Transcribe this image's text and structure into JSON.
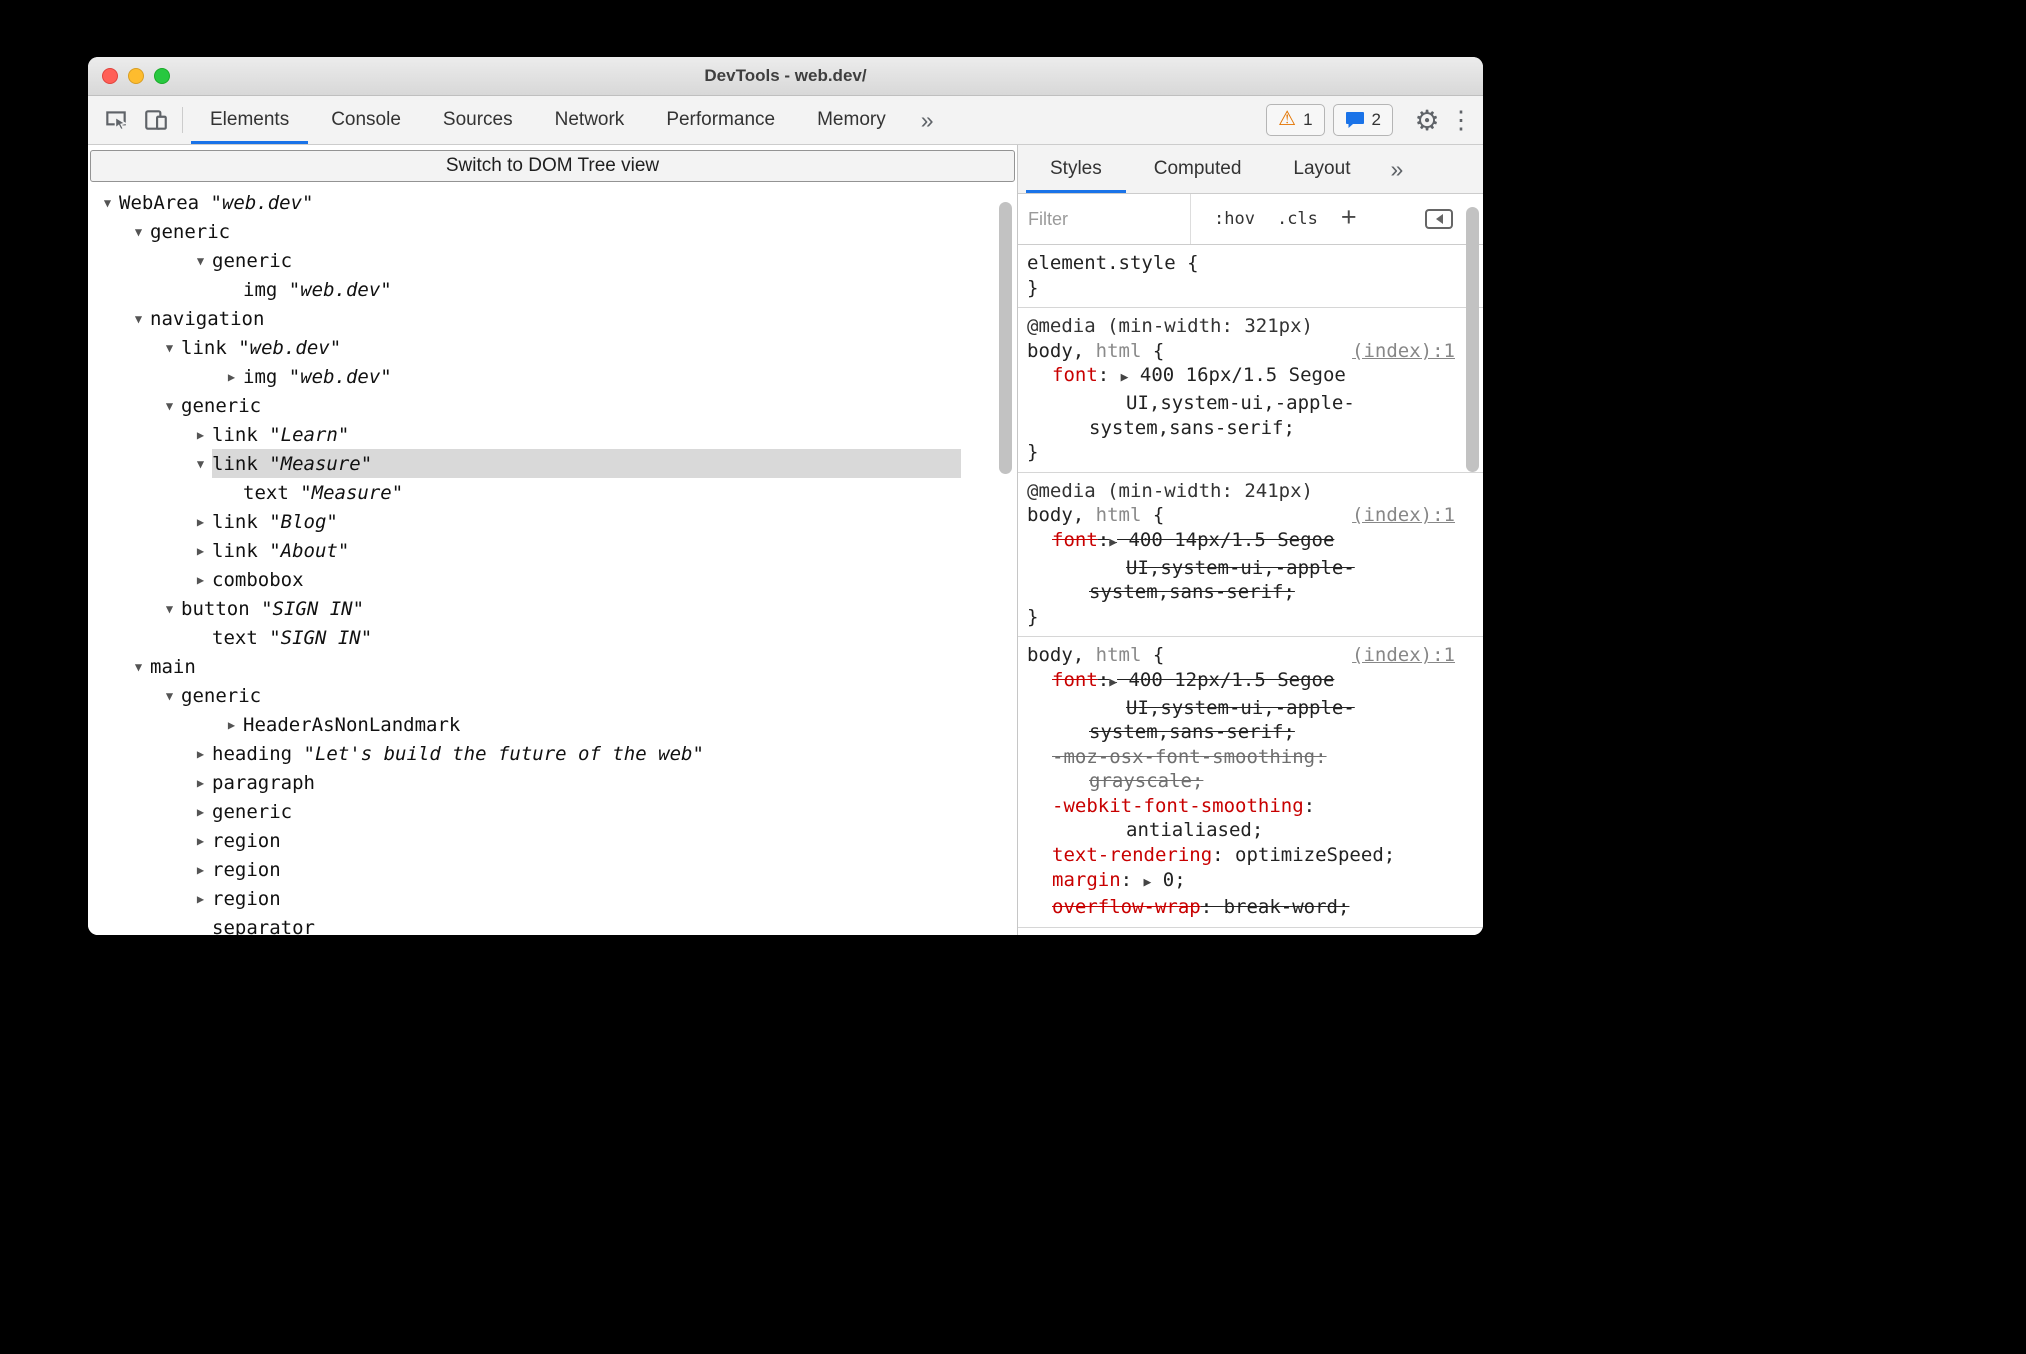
{
  "colors": {
    "accent-blue": "#1a73e8",
    "property-red": "#c80000",
    "warning-orange": "#e37400",
    "selection-gray": "#d9d9d9",
    "traffic-red": "#ff5f57",
    "traffic-yellow": "#febc2e",
    "traffic-green": "#28c840"
  },
  "window": {
    "title": "DevTools - web.dev/"
  },
  "toolbar": {
    "tabs": [
      {
        "label": "Elements",
        "active": true
      },
      {
        "label": "Console"
      },
      {
        "label": "Sources"
      },
      {
        "label": "Network"
      },
      {
        "label": "Performance"
      },
      {
        "label": "Memory"
      }
    ],
    "more_tabs": "»",
    "warning_badge": "1",
    "message_badge": "2"
  },
  "dom_switch": {
    "label": "Switch to DOM Tree view"
  },
  "accessibility_tree": {
    "rows": [
      {
        "role": "WebArea",
        "value": "web.dev",
        "state": "expanded",
        "level": 0
      },
      {
        "role": "generic",
        "state": "expanded",
        "level": 1
      },
      {
        "role": "generic",
        "state": "expanded",
        "level": 2,
        "bump": true
      },
      {
        "role": "img",
        "value": "web.dev",
        "state": "leaf",
        "level": 3,
        "bump": true
      },
      {
        "role": "navigation",
        "state": "expanded",
        "level": 1
      },
      {
        "role": "link",
        "value": "web.dev",
        "state": "expanded",
        "level": 2
      },
      {
        "role": "img",
        "value": "web.dev",
        "state": "collapsed",
        "level": 3,
        "bump": true
      },
      {
        "role": "generic",
        "state": "expanded",
        "level": 2
      },
      {
        "role": "link",
        "value": "Learn",
        "state": "collapsed",
        "level": 3
      },
      {
        "role": "link",
        "value": "Measure",
        "state": "expanded",
        "level": 3,
        "selected": true
      },
      {
        "role": "text",
        "value": "Measure",
        "state": "leaf",
        "level": 4
      },
      {
        "role": "link",
        "value": "Blog",
        "state": "collapsed",
        "level": 3
      },
      {
        "role": "link",
        "value": "About",
        "state": "collapsed",
        "level": 3
      },
      {
        "role": "combobox",
        "state": "collapsed",
        "level": 3
      },
      {
        "role": "button",
        "value": "SIGN IN",
        "state": "expanded",
        "level": 2
      },
      {
        "role": "text",
        "value": "SIGN IN",
        "state": "leaf",
        "level": 3
      },
      {
        "role": "main",
        "state": "expanded",
        "level": 1
      },
      {
        "role": "generic",
        "state": "expanded",
        "level": 2
      },
      {
        "role": "HeaderAsNonLandmark",
        "state": "collapsed",
        "level": 3,
        "bump": true
      },
      {
        "role": "heading",
        "value": "Let's build the future of the web",
        "state": "collapsed",
        "level": 3
      },
      {
        "role": "paragraph",
        "state": "collapsed",
        "level": 3
      },
      {
        "role": "generic",
        "state": "collapsed",
        "level": 3
      },
      {
        "role": "region",
        "state": "collapsed",
        "level": 3
      },
      {
        "role": "region",
        "state": "collapsed",
        "level": 3
      },
      {
        "role": "region",
        "state": "collapsed",
        "level": 3
      },
      {
        "role": "separator",
        "state": "leaf",
        "level": 3
      }
    ]
  },
  "sidebar": {
    "tabs": [
      {
        "label": "Styles",
        "active": true
      },
      {
        "label": "Computed"
      },
      {
        "label": "Layout"
      }
    ],
    "more_tabs": "»",
    "filter_placeholder": "Filter",
    "hov_label": ":hov",
    "cls_label": ".cls",
    "add_label": "+",
    "sections": [
      {
        "name": "element-style-rule",
        "lines": [
          {
            "name": "css-selector-line",
            "ind": 0,
            "spans": [
              {
                "t": "element.style {",
                "c": "sel"
              }
            ]
          },
          {
            "name": "css-close-brace",
            "ind": 0,
            "spans": [
              {
                "t": "}",
                "c": "sel"
              }
            ]
          }
        ]
      },
      {
        "name": "media-321-rule",
        "lines": [
          {
            "name": "media-query",
            "ind": 0,
            "spans": [
              {
                "t": "@media (min-width: 321px)",
                "c": "media"
              }
            ]
          },
          {
            "name": "css-selector-line",
            "ind": 0,
            "link": "(index):1",
            "spans": [
              {
                "t": "body, ",
                "c": "sel"
              },
              {
                "t": "html",
                "c": "selmuted"
              },
              {
                "t": " {",
                "c": "sel"
              }
            ]
          },
          {
            "name": "css-declaration",
            "ind": 1,
            "spans": [
              {
                "t": "font",
                "c": "prop"
              },
              {
                "t": ": ",
                "c": "plain"
              },
              {
                "t": "▶",
                "c": "arrow"
              },
              {
                "t": " 400 16px/1.5 Segoe",
                "c": "val"
              }
            ]
          },
          {
            "name": "css-value-wrap",
            "ind": 3,
            "spans": [
              {
                "t": "UI,system-ui,-apple-",
                "c": "val"
              }
            ]
          },
          {
            "name": "css-value-wrap",
            "ind": 2,
            "spans": [
              {
                "t": "system,sans-serif;",
                "c": "val"
              }
            ]
          },
          {
            "name": "css-close-brace",
            "ind": 0,
            "spans": [
              {
                "t": "}",
                "c": "sel"
              }
            ]
          }
        ]
      },
      {
        "name": "media-241-rule",
        "lines": [
          {
            "name": "media-query",
            "ind": 0,
            "spans": [
              {
                "t": "@media (min-width: 241px)",
                "c": "media"
              }
            ]
          },
          {
            "name": "css-selector-line",
            "ind": 0,
            "link": "(index):1",
            "spans": [
              {
                "t": "body, ",
                "c": "sel"
              },
              {
                "t": "html",
                "c": "selmuted"
              },
              {
                "t": " {",
                "c": "sel"
              }
            ]
          },
          {
            "name": "css-declaration",
            "ind": 1,
            "spans": [
              {
                "t": "font",
                "c": "prop",
                "s": true
              },
              {
                "t": ":",
                "c": "plain",
                "s": true
              },
              {
                "t": "▶",
                "c": "arrow",
                "s": true
              },
              {
                "t": " 400 14px/1.5 Segoe",
                "c": "val",
                "s": true
              }
            ]
          },
          {
            "name": "css-value-wrap",
            "ind": 3,
            "spans": [
              {
                "t": "UI,system-ui,-apple-",
                "c": "val",
                "s": true
              }
            ]
          },
          {
            "name": "css-value-wrap",
            "ind": 2,
            "spans": [
              {
                "t": "system,sans-serif;",
                "c": "val",
                "s": true
              }
            ]
          },
          {
            "name": "css-close-brace",
            "ind": 0,
            "spans": [
              {
                "t": "}",
                "c": "sel"
              }
            ]
          }
        ]
      },
      {
        "name": "base-body-html-rule",
        "lines": [
          {
            "name": "css-selector-line",
            "ind": 0,
            "link": "(index):1",
            "spans": [
              {
                "t": "body, ",
                "c": "sel"
              },
              {
                "t": "html",
                "c": "selmuted"
              },
              {
                "t": " {",
                "c": "sel"
              }
            ]
          },
          {
            "name": "css-declaration",
            "ind": 1,
            "spans": [
              {
                "t": "font",
                "c": "prop",
                "s": true
              },
              {
                "t": ":",
                "c": "plain",
                "s": true
              },
              {
                "t": "▶",
                "c": "arrow",
                "s": true
              },
              {
                "t": " 400 12px/1.5 Segoe",
                "c": "val",
                "s": true
              }
            ]
          },
          {
            "name": "css-value-wrap",
            "ind": 3,
            "spans": [
              {
                "t": "UI,system-ui,-apple-",
                "c": "val",
                "s": true
              }
            ]
          },
          {
            "name": "css-value-wrap",
            "ind": 2,
            "spans": [
              {
                "t": "system,sans-serif;",
                "c": "val",
                "s": true
              }
            ]
          },
          {
            "name": "css-declaration",
            "ind": 1,
            "spans": [
              {
                "t": "-moz-osx-font-smoothing:",
                "c": "muted",
                "s": true
              }
            ]
          },
          {
            "name": "css-value-wrap",
            "ind": 2,
            "spans": [
              {
                "t": "grayscale;",
                "c": "muted",
                "s": true
              }
            ]
          },
          {
            "name": "css-declaration",
            "ind": 1,
            "spans": [
              {
                "t": "-webkit-font-smoothing",
                "c": "prop"
              },
              {
                "t": ":",
                "c": "plain"
              }
            ]
          },
          {
            "name": "css-value-wrap",
            "ind": 3,
            "spans": [
              {
                "t": "antialiased;",
                "c": "val"
              }
            ]
          },
          {
            "name": "css-declaration",
            "ind": 1,
            "spans": [
              {
                "t": "text-rendering",
                "c": "prop"
              },
              {
                "t": ": ",
                "c": "plain"
              },
              {
                "t": "optimizeSpeed;",
                "c": "val"
              }
            ]
          },
          {
            "name": "css-declaration",
            "ind": 1,
            "spans": [
              {
                "t": "margin",
                "c": "prop"
              },
              {
                "t": ": ",
                "c": "plain"
              },
              {
                "t": "▶",
                "c": "arrow"
              },
              {
                "t": " 0;",
                "c": "val"
              }
            ]
          },
          {
            "name": "css-declaration",
            "ind": 1,
            "spans": [
              {
                "t": "overflow-wrap",
                "c": "prop",
                "s": true
              },
              {
                "t": ": ",
                "c": "plain",
                "s": true
              },
              {
                "t": "break-word;",
                "c": "val",
                "s": true
              }
            ]
          }
        ]
      }
    ]
  }
}
